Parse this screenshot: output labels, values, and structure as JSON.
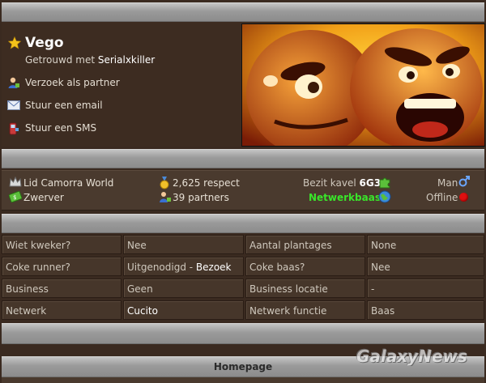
{
  "profile": {
    "name": "Vego",
    "married_prefix": "Getrouwd met",
    "married_to": "Serialxkiller",
    "actions": [
      {
        "label": "Verzoek als partner",
        "icon": "partner-request-icon"
      },
      {
        "label": "Stuur een email",
        "icon": "email-icon"
      },
      {
        "label": "Stuur een SMS",
        "icon": "phone-sms-icon"
      }
    ]
  },
  "stats": {
    "membership": "Lid Camorra World",
    "rank": "Zwerver",
    "respect": "2,625 respect",
    "partners": "39 partners",
    "plot_prefix": "Bezit kavel",
    "plot_value": "6G3",
    "network_role": "Netwerkbaas",
    "gender": "Man",
    "status": "Offline"
  },
  "details": {
    "rows": [
      {
        "k1": "Wiet kweker?",
        "v1": "Nee",
        "k2": "Aantal plantages",
        "v2": "None"
      },
      {
        "k1": "Coke runner?",
        "v1": "Uitgenodigd - ",
        "v1_link": "Bezoek",
        "k2": "Coke baas?",
        "v2": "Nee"
      },
      {
        "k1": "Business",
        "v1": "Geen",
        "k2": "Business locatie",
        "v2": "-"
      },
      {
        "k1": "Netwerk",
        "v1": "Cucito",
        "k2": "Netwerk functie",
        "v2": "Baas"
      }
    ]
  },
  "homepage": {
    "label": "Homepage"
  },
  "watermark": {
    "text": "GalaxyNews"
  },
  "colors": {
    "accent_green": "#39e52a",
    "status_red": "#e01010",
    "background": "#3a2a20"
  }
}
